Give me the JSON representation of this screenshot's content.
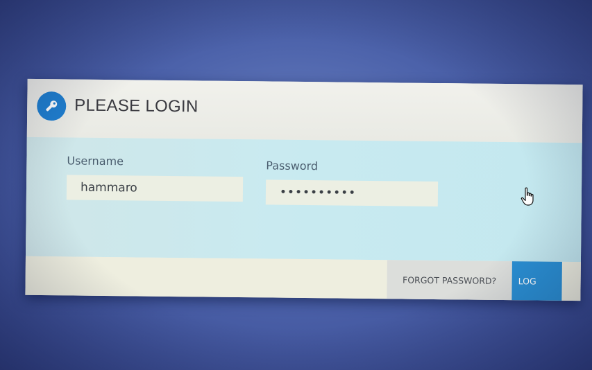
{
  "dialog": {
    "title": "PLEASE LOGIN",
    "icon": "key-icon"
  },
  "form": {
    "username_label": "Username",
    "username_value": "hammaro",
    "password_label": "Password",
    "password_value": "••••••••••"
  },
  "footer": {
    "forgot_label": "FORGOT PASSWORD?",
    "login_label": "LOG"
  },
  "colors": {
    "accent": "#2a8fd3",
    "icon_bg": "#1f7fd0",
    "body_bg": "#c9eaf0",
    "desktop_bg": "#4c62aa"
  }
}
